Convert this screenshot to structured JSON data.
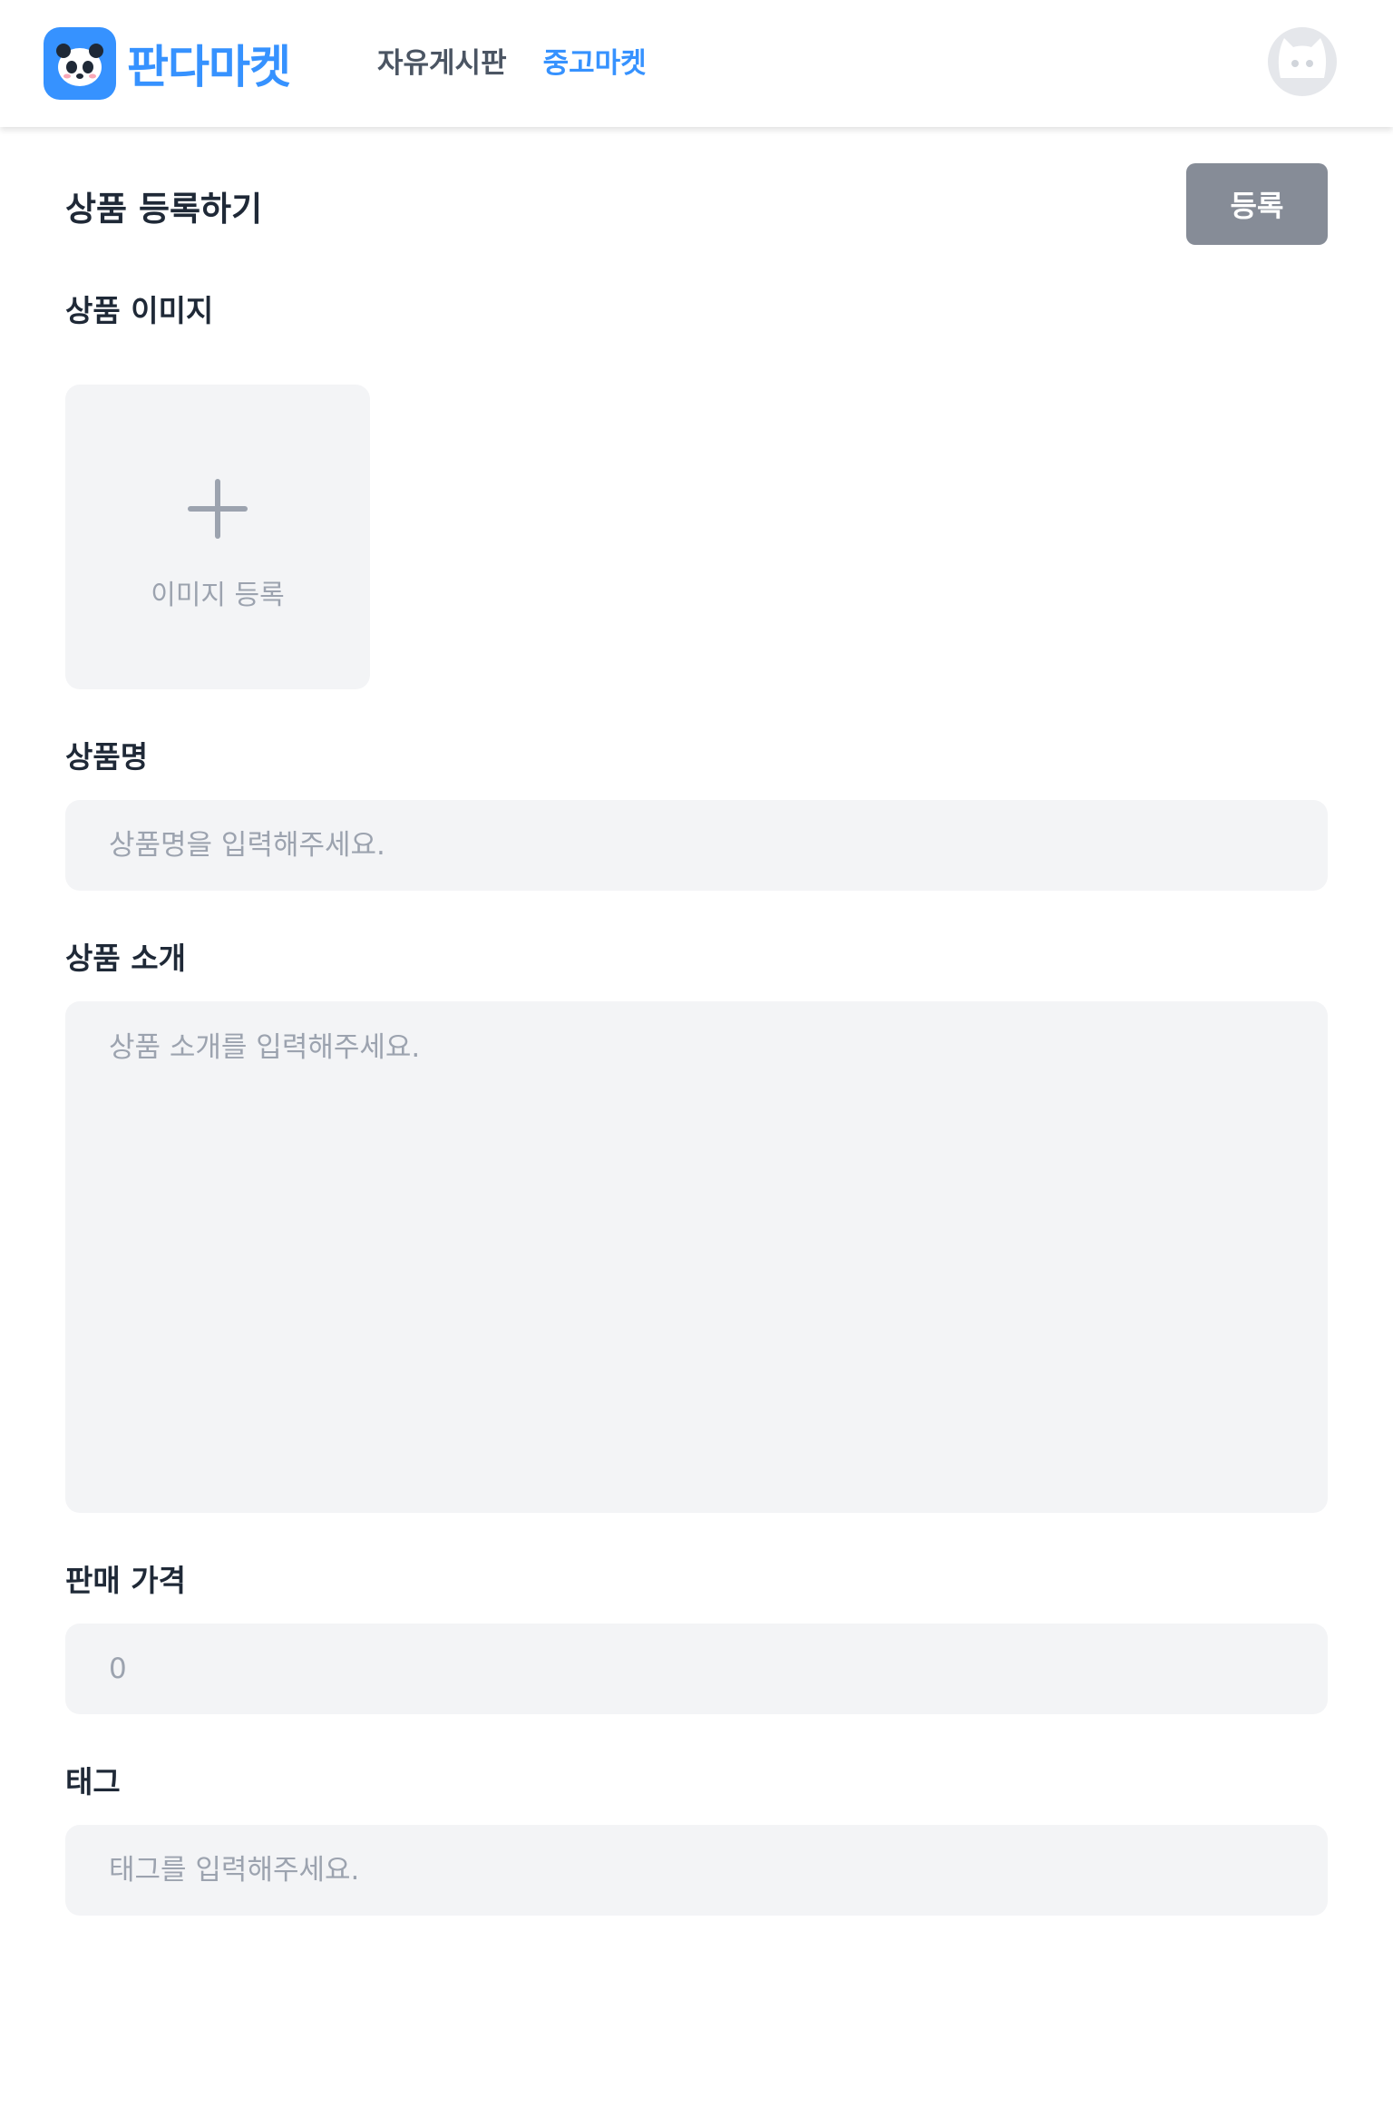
{
  "header": {
    "logo_text": "판다마켓",
    "nav": [
      {
        "label": "자유게시판",
        "active": false
      },
      {
        "label": "중고마켓",
        "active": true
      }
    ]
  },
  "page": {
    "title": "상품 등록하기",
    "submit_label": "등록"
  },
  "form": {
    "image": {
      "label": "상품 이미지",
      "upload_label": "이미지 등록"
    },
    "name": {
      "label": "상품명",
      "placeholder": "상품명을 입력해주세요.",
      "value": ""
    },
    "description": {
      "label": "상품 소개",
      "placeholder": "상품 소개를 입력해주세요.",
      "value": ""
    },
    "price": {
      "label": "판매 가격",
      "placeholder": "0",
      "value": ""
    },
    "tags": {
      "label": "태그",
      "placeholder": "태그를 입력해주세요.",
      "value": ""
    }
  },
  "colors": {
    "brand": "#3692ff",
    "submit_disabled": "#9ca3af",
    "field_bg": "#f3f4f6",
    "placeholder": "#9ca3af"
  }
}
